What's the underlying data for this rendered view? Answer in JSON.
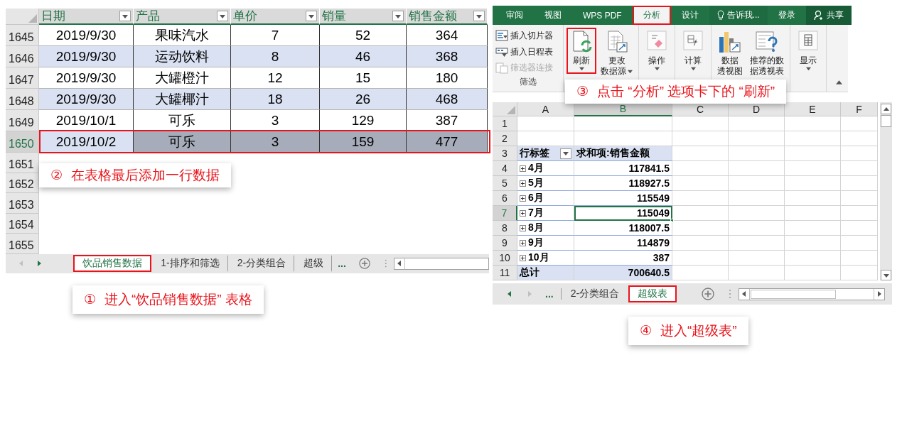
{
  "left_panel": {
    "sheet": {
      "columns": [
        "日期",
        "产品",
        "单价",
        "销量",
        "销售金额"
      ],
      "rows": [
        {
          "row_number": "1645",
          "cells": [
            "2019/9/30",
            "果味汽水",
            "7",
            "52",
            "364"
          ],
          "banded": false,
          "selected": false
        },
        {
          "row_number": "1646",
          "cells": [
            "2019/9/30",
            "运动饮料",
            "8",
            "46",
            "368"
          ],
          "banded": true,
          "selected": false
        },
        {
          "row_number": "1647",
          "cells": [
            "2019/9/30",
            "大罐橙汁",
            "12",
            "15",
            "180"
          ],
          "banded": false,
          "selected": false
        },
        {
          "row_number": "1648",
          "cells": [
            "2019/9/30",
            "大罐椰汁",
            "18",
            "26",
            "468"
          ],
          "banded": true,
          "selected": false
        },
        {
          "row_number": "1649",
          "cells": [
            "2019/10/1",
            "可乐",
            "3",
            "129",
            "387"
          ],
          "banded": false,
          "selected": false
        },
        {
          "row_number": "1650",
          "cells": [
            "2019/10/2",
            "可乐",
            "3",
            "159",
            "477"
          ],
          "banded": true,
          "selected": true
        }
      ],
      "empty_rows": [
        "1651",
        "1652",
        "1653",
        "1654",
        "1655"
      ]
    },
    "note_over": {
      "number": "②",
      "text": "在表格最后添加一行数据"
    },
    "tabs": {
      "items": [
        {
          "label": "饮品销售数据",
          "selected": true
        },
        {
          "label": "1-排序和筛选",
          "selected": false
        },
        {
          "label": "2-分类组合",
          "selected": false
        },
        {
          "label": "超级",
          "selected": false
        }
      ],
      "more": "..."
    },
    "note_below": {
      "number": "①",
      "text": "进入“饮品销售数据” 表格"
    }
  },
  "right_panel": {
    "ribbon": {
      "tabs": [
        {
          "label": "审阅",
          "kind": "tab",
          "selected": false
        },
        {
          "label": "视图",
          "kind": "tab",
          "selected": false
        },
        {
          "label": "WPS PDF",
          "kind": "tab",
          "selected": false
        },
        {
          "label": "分析",
          "kind": "tab",
          "selected": true
        },
        {
          "label": "设计",
          "kind": "tab",
          "selected": false
        },
        {
          "label": "告诉我...",
          "kind": "tell",
          "selected": false
        },
        {
          "label": "登录",
          "kind": "tab",
          "selected": false
        },
        {
          "label": "共享",
          "kind": "share",
          "selected": false
        }
      ],
      "filter_group": {
        "label": "筛选",
        "items": [
          {
            "label": "插入切片器",
            "kind": "slicer",
            "disabled": false
          },
          {
            "label": "插入日程表",
            "kind": "timeline",
            "disabled": false
          },
          {
            "label": "筛选器连接",
            "kind": "connect",
            "disabled": true
          }
        ]
      },
      "groups": [
        [
          {
            "lines": [
              "刷新"
            ],
            "kind": "refresh",
            "dropdown": true,
            "selected": true
          },
          {
            "lines": [
              "更改",
              "数据源"
            ],
            "kind": "source",
            "dropdown": true,
            "selected": false
          }
        ],
        [
          {
            "lines": [
              "操作"
            ],
            "kind": "actions",
            "dropdown": true,
            "selected": false
          }
        ],
        [
          {
            "lines": [
              "计算"
            ],
            "kind": "calc",
            "dropdown": true,
            "selected": false
          }
        ],
        [
          {
            "lines": [
              "数据",
              "透视图"
            ],
            "kind": "chart",
            "selected": false
          },
          {
            "lines": [
              "推荐的数",
              "据透视表"
            ],
            "kind": "recommend",
            "selected": false
          }
        ],
        [
          {
            "lines": [
              "显示"
            ],
            "kind": "show",
            "dropdown": true,
            "selected": false
          }
        ]
      ]
    },
    "note_over": {
      "number": "③",
      "text": "点击 “分析” 选项卡下的 “刷新”"
    },
    "sheet": {
      "columns": [
        {
          "label": "A",
          "selected": false
        },
        {
          "label": "B",
          "selected": true
        },
        {
          "label": "C",
          "selected": false
        },
        {
          "label": "D",
          "selected": false
        },
        {
          "label": "E",
          "selected": false
        },
        {
          "label": "F",
          "selected": false
        }
      ],
      "rows": [
        {
          "row_number": "1",
          "kind": "blank",
          "selected": false
        },
        {
          "row_number": "2",
          "kind": "blank",
          "selected": false
        },
        {
          "row_number": "3",
          "kind": "header",
          "label": "行标签",
          "value": "求和项:销售金额",
          "selected": false
        },
        {
          "row_number": "4",
          "kind": "item",
          "label": "4月",
          "value": "117841.5",
          "selected": false
        },
        {
          "row_number": "5",
          "kind": "item",
          "label": "5月",
          "value": "118927.5",
          "selected": false
        },
        {
          "row_number": "6",
          "kind": "item",
          "label": "6月",
          "value": "115549",
          "selected": false
        },
        {
          "row_number": "7",
          "kind": "item",
          "label": "7月",
          "value": "115049",
          "selected": true
        },
        {
          "row_number": "8",
          "kind": "item",
          "label": "8月",
          "value": "118007.5",
          "selected": false
        },
        {
          "row_number": "9",
          "kind": "item",
          "label": "9月",
          "value": "114879",
          "selected": false
        },
        {
          "row_number": "10",
          "kind": "item",
          "label": "10月",
          "value": "387",
          "selected": false
        },
        {
          "row_number": "11",
          "kind": "total",
          "label": "总计",
          "value": "700640.5",
          "selected": false
        }
      ]
    },
    "tabs": {
      "more": "...",
      "items": [
        {
          "label": "2-分类组合",
          "selected": false
        },
        {
          "label": "超级表",
          "selected": true
        }
      ]
    },
    "note_below": {
      "number": "④",
      "text": "进入“超级表”"
    }
  }
}
